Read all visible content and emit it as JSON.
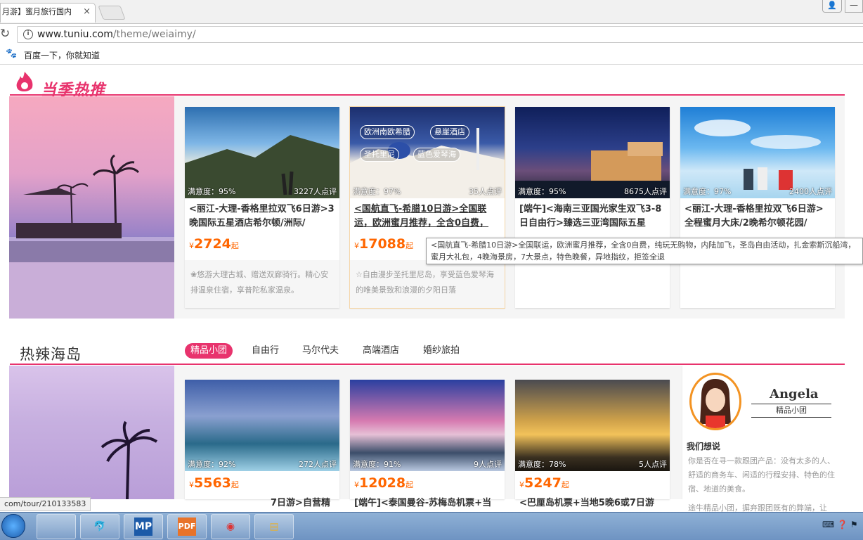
{
  "browser": {
    "tab_title": "月游】蜜月旅行国内",
    "tab_close": "×",
    "url_host": "www.tuniu.com",
    "url_path": "/theme/weiaimy/",
    "bookmark_label": "百度一下，你就知道",
    "status_url": "com/tour/210133583"
  },
  "section1": {
    "title": "当季热推",
    "cards": [
      {
        "satisfaction": "满意度：95%",
        "reviews": "3227人点评",
        "title": "<丽江-大理-香格里拉双飞6日游>3晚国际五星酒店希尔顿/洲际/",
        "currency": "¥",
        "price": "2724",
        "qi": "起",
        "desc": "❀悠游大理古城、赠送双廊骑行。精心安排温泉住宿，享普陀私家温泉。"
      },
      {
        "satisfaction": "满意度：97%",
        "reviews": "35人点评",
        "title": "<国航直飞-希腊10日游>全国联运，欧洲蜜月推荐，全含0自费，",
        "currency": "¥",
        "price": "17088",
        "qi": "起",
        "desc": "☆自由漫步圣托里尼岛，享受蓝色爱琴海的唯美景致和浪漫的夕阳日落",
        "tags": [
          "欧洲南欧希腊",
          "悬崖酒店",
          "圣托里尼",
          "蓝色爱琴海"
        ]
      },
      {
        "satisfaction": "满意度：95%",
        "reviews": "8675人点评",
        "title": "[端午]<海南三亚国光家生双飞3-8日自由行>臻选三亚湾国际五星"
      },
      {
        "satisfaction": "满意度：97%",
        "reviews": "2400人点评",
        "title": "<丽江-大理-香格里拉双飞6日游>全程蜜月大床/2晚希尔顿花园/"
      }
    ],
    "tooltip": "<国航直飞-希腊10日游>全国联运，欧洲蜜月推荐，全含0自费，纯玩无购物，内陆加飞，圣岛自由活动，扎金索斯沉船湾，蜜月大礼包，4晚海景房，7大景点，特色晚餐，异地指纹，拒签全退"
  },
  "section2": {
    "title": "热辣海岛",
    "tabs": [
      "精品小团",
      "自由行",
      "马尔代夫",
      "高端酒店",
      "婚纱旅拍"
    ],
    "cards": [
      {
        "satisfaction": "满意度：92%",
        "reviews": "272人点评",
        "currency": "¥",
        "price": "5563",
        "qi": "起",
        "title": "7日游>自营精"
      },
      {
        "satisfaction": "满意度：91%",
        "reviews": "9人点评",
        "currency": "¥",
        "price": "12028",
        "qi": "起",
        "title": "[端午]<泰国曼谷-苏梅岛机票+当"
      },
      {
        "satisfaction": "满意度：78%",
        "reviews": "5人点评",
        "currency": "¥",
        "price": "5247",
        "qi": "起",
        "title": "<巴厘岛机票+当地5晚6或7日游"
      }
    ],
    "guide": {
      "name": "Angela",
      "role": "精品小团",
      "heading": "我们想说",
      "text": "你是否在寻一款跟团产品：没有太多的人、舒适的商务车、闲适的行程安排、特色的住宿、地道的美食。",
      "text2": "途牛精品小团，摒弃跟团既有的弊端，让"
    }
  },
  "taskbar": {
    "apps": [
      "",
      "",
      "MP",
      "PDF",
      "",
      ""
    ]
  }
}
